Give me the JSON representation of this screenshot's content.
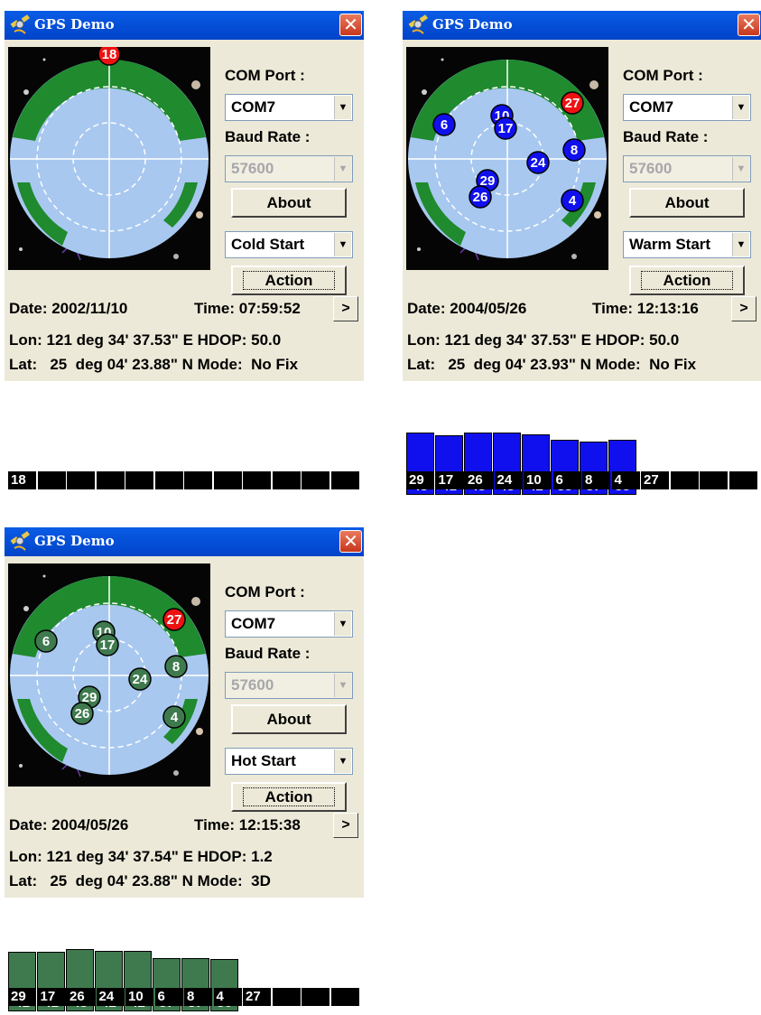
{
  "app": {
    "title": "GPS Demo",
    "close_glyph": "✕"
  },
  "labels": {
    "com_port": "COM Port :",
    "baud_rate": "Baud Rate :",
    "about": "About",
    "action": "Action",
    "next_glyph": ">"
  },
  "colors": {
    "title_bar": "#0a5ce6",
    "tracked_sat": "#1010ee",
    "fixed_sat": "#3f7a4f",
    "unused_sat": "#ee1111",
    "earth_land": "#1f8a2e",
    "earth_sea": "#a8c8f0"
  },
  "windows": [
    {
      "com_port": "COM7",
      "baud_rate": "57600",
      "start_mode": "Cold Start",
      "date_line": "Date: 2002/11/10",
      "time_line": "Time: 07:59:52",
      "lon_line": "Lon: 121 deg 34' 37.53\" E HDOP: 50.0",
      "lat_line": "Lat:   25  deg 04' 23.88\" N Mode:  No Fix",
      "sats": [
        {
          "id": "18",
          "state": "unused"
        }
      ],
      "bars": [],
      "prns": [
        "18",
        "",
        "",
        "",
        "",
        "",
        "",
        "",
        "",
        "",
        "",
        ""
      ]
    },
    {
      "com_port": "COM7",
      "baud_rate": "57600",
      "start_mode": "Warm Start",
      "date_line": "Date: 2004/05/26",
      "time_line": "Time: 12:13:16",
      "lon_line": "Lon: 121 deg 34' 37.53\" E HDOP: 50.0",
      "lat_line": "Lat:   25  deg 04' 23.93\" N Mode:  No Fix",
      "sats": [
        {
          "id": "27",
          "state": "unused"
        },
        {
          "id": "6",
          "state": "tracked"
        },
        {
          "id": "10",
          "state": "tracked"
        },
        {
          "id": "17",
          "state": "tracked"
        },
        {
          "id": "8",
          "state": "tracked"
        },
        {
          "id": "24",
          "state": "tracked"
        },
        {
          "id": "29",
          "state": "tracked"
        },
        {
          "id": "26",
          "state": "tracked"
        },
        {
          "id": "4",
          "state": "tracked"
        }
      ],
      "bars": [
        43,
        41,
        43,
        43,
        42,
        38,
        37,
        38
      ],
      "prns": [
        "29",
        "17",
        "26",
        "24",
        "10",
        "6",
        "8",
        "4",
        "27",
        "",
        "",
        ""
      ]
    },
    {
      "com_port": "COM7",
      "baud_rate": "57600",
      "start_mode": "Hot Start",
      "date_line": "Date: 2004/05/26",
      "time_line": "Time: 12:15:38",
      "lon_line": "Lon: 121 deg 34' 37.54\" E HDOP: 1.2",
      "lat_line": "Lat:   25  deg 04' 23.88\" N Mode:  3D",
      "sats": [
        {
          "id": "27",
          "state": "unused"
        },
        {
          "id": "6",
          "state": "fixed"
        },
        {
          "id": "10",
          "state": "fixed"
        },
        {
          "id": "17",
          "state": "fixed"
        },
        {
          "id": "8",
          "state": "fixed"
        },
        {
          "id": "24",
          "state": "fixed"
        },
        {
          "id": "29",
          "state": "fixed"
        },
        {
          "id": "26",
          "state": "fixed"
        },
        {
          "id": "4",
          "state": "fixed"
        }
      ],
      "bars": [
        41,
        41,
        43,
        42,
        42,
        37,
        37,
        36
      ],
      "prns": [
        "29",
        "17",
        "26",
        "24",
        "10",
        "6",
        "8",
        "4",
        "27",
        "",
        "",
        ""
      ]
    }
  ]
}
